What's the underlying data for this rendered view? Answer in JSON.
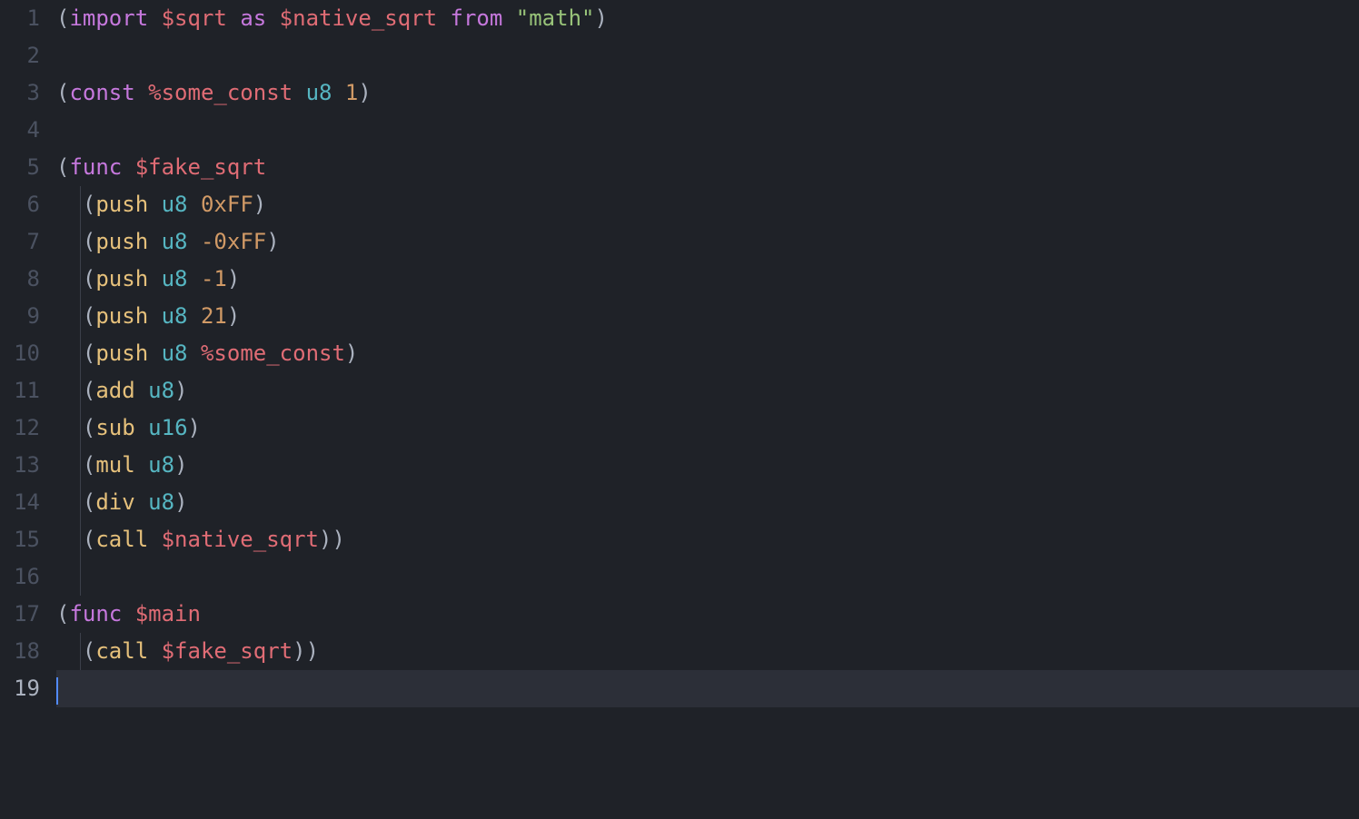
{
  "editor": {
    "active_line": 19,
    "lines": [
      {
        "n": 1,
        "indent_guide": false,
        "active": false
      },
      {
        "n": 2,
        "indent_guide": false,
        "active": false
      },
      {
        "n": 3,
        "indent_guide": false,
        "active": false
      },
      {
        "n": 4,
        "indent_guide": false,
        "active": false
      },
      {
        "n": 5,
        "indent_guide": false,
        "active": false
      },
      {
        "n": 6,
        "indent_guide": true,
        "active": false
      },
      {
        "n": 7,
        "indent_guide": true,
        "active": false
      },
      {
        "n": 8,
        "indent_guide": true,
        "active": false
      },
      {
        "n": 9,
        "indent_guide": true,
        "active": false
      },
      {
        "n": 10,
        "indent_guide": true,
        "active": false
      },
      {
        "n": 11,
        "indent_guide": true,
        "active": false
      },
      {
        "n": 12,
        "indent_guide": true,
        "active": false
      },
      {
        "n": 13,
        "indent_guide": true,
        "active": false
      },
      {
        "n": 14,
        "indent_guide": true,
        "active": false
      },
      {
        "n": 15,
        "indent_guide": true,
        "active": false
      },
      {
        "n": 16,
        "indent_guide": true,
        "active": false
      },
      {
        "n": 17,
        "indent_guide": false,
        "active": false
      },
      {
        "n": 18,
        "indent_guide": true,
        "active": false
      },
      {
        "n": 19,
        "indent_guide": false,
        "active": true
      }
    ]
  },
  "code": {
    "l1": [
      {
        "t": "(",
        "c": "pn"
      },
      {
        "t": "import",
        "c": "kw"
      },
      {
        "t": " "
      },
      {
        "t": "$sqrt",
        "c": "nm"
      },
      {
        "t": " "
      },
      {
        "t": "as",
        "c": "kw"
      },
      {
        "t": " "
      },
      {
        "t": "$native_sqrt",
        "c": "nm"
      },
      {
        "t": " "
      },
      {
        "t": "from",
        "c": "kw"
      },
      {
        "t": " "
      },
      {
        "t": "\"math\"",
        "c": "str"
      },
      {
        "t": ")",
        "c": "pn"
      }
    ],
    "l2": [],
    "l3": [
      {
        "t": "(",
        "c": "pn"
      },
      {
        "t": "const",
        "c": "kw"
      },
      {
        "t": " "
      },
      {
        "t": "%some_const",
        "c": "nm"
      },
      {
        "t": " "
      },
      {
        "t": "u8",
        "c": "ty"
      },
      {
        "t": " "
      },
      {
        "t": "1",
        "c": "num"
      },
      {
        "t": ")",
        "c": "pn"
      }
    ],
    "l4": [],
    "l5": [
      {
        "t": "(",
        "c": "pn"
      },
      {
        "t": "func",
        "c": "kw"
      },
      {
        "t": " "
      },
      {
        "t": "$fake_sqrt",
        "c": "nm"
      }
    ],
    "l6": [
      {
        "t": "  "
      },
      {
        "t": "(",
        "c": "pn"
      },
      {
        "t": "push",
        "c": "fn"
      },
      {
        "t": " "
      },
      {
        "t": "u8",
        "c": "ty"
      },
      {
        "t": " "
      },
      {
        "t": "0xFF",
        "c": "num"
      },
      {
        "t": ")",
        "c": "pn"
      }
    ],
    "l7": [
      {
        "t": "  "
      },
      {
        "t": "(",
        "c": "pn"
      },
      {
        "t": "push",
        "c": "fn"
      },
      {
        "t": " "
      },
      {
        "t": "u8",
        "c": "ty"
      },
      {
        "t": " "
      },
      {
        "t": "-0xFF",
        "c": "num"
      },
      {
        "t": ")",
        "c": "pn"
      }
    ],
    "l8": [
      {
        "t": "  "
      },
      {
        "t": "(",
        "c": "pn"
      },
      {
        "t": "push",
        "c": "fn"
      },
      {
        "t": " "
      },
      {
        "t": "u8",
        "c": "ty"
      },
      {
        "t": " "
      },
      {
        "t": "-1",
        "c": "num"
      },
      {
        "t": ")",
        "c": "pn"
      }
    ],
    "l9": [
      {
        "t": "  "
      },
      {
        "t": "(",
        "c": "pn"
      },
      {
        "t": "push",
        "c": "fn"
      },
      {
        "t": " "
      },
      {
        "t": "u8",
        "c": "ty"
      },
      {
        "t": " "
      },
      {
        "t": "21",
        "c": "num"
      },
      {
        "t": ")",
        "c": "pn"
      }
    ],
    "l10": [
      {
        "t": "  "
      },
      {
        "t": "(",
        "c": "pn"
      },
      {
        "t": "push",
        "c": "fn"
      },
      {
        "t": " "
      },
      {
        "t": "u8",
        "c": "ty"
      },
      {
        "t": " "
      },
      {
        "t": "%some_const",
        "c": "nm"
      },
      {
        "t": ")",
        "c": "pn"
      }
    ],
    "l11": [
      {
        "t": "  "
      },
      {
        "t": "(",
        "c": "pn"
      },
      {
        "t": "add",
        "c": "fn"
      },
      {
        "t": " "
      },
      {
        "t": "u8",
        "c": "ty"
      },
      {
        "t": ")",
        "c": "pn"
      }
    ],
    "l12": [
      {
        "t": "  "
      },
      {
        "t": "(",
        "c": "pn"
      },
      {
        "t": "sub",
        "c": "fn"
      },
      {
        "t": " "
      },
      {
        "t": "u16",
        "c": "ty"
      },
      {
        "t": ")",
        "c": "pn"
      }
    ],
    "l13": [
      {
        "t": "  "
      },
      {
        "t": "(",
        "c": "pn"
      },
      {
        "t": "mul",
        "c": "fn"
      },
      {
        "t": " "
      },
      {
        "t": "u8",
        "c": "ty"
      },
      {
        "t": ")",
        "c": "pn"
      }
    ],
    "l14": [
      {
        "t": "  "
      },
      {
        "t": "(",
        "c": "pn"
      },
      {
        "t": "div",
        "c": "fn"
      },
      {
        "t": " "
      },
      {
        "t": "u8",
        "c": "ty"
      },
      {
        "t": ")",
        "c": "pn"
      }
    ],
    "l15": [
      {
        "t": "  "
      },
      {
        "t": "(",
        "c": "pn"
      },
      {
        "t": "call",
        "c": "fn"
      },
      {
        "t": " "
      },
      {
        "t": "$native_sqrt",
        "c": "nm"
      },
      {
        "t": ")",
        "c": "pn"
      },
      {
        "t": ")",
        "c": "pn"
      }
    ],
    "l16": [],
    "l17": [
      {
        "t": "(",
        "c": "pn"
      },
      {
        "t": "func",
        "c": "kw"
      },
      {
        "t": " "
      },
      {
        "t": "$main",
        "c": "nm"
      }
    ],
    "l18": [
      {
        "t": "  "
      },
      {
        "t": "(",
        "c": "pn"
      },
      {
        "t": "call",
        "c": "fn"
      },
      {
        "t": " "
      },
      {
        "t": "$fake_sqrt",
        "c": "nm"
      },
      {
        "t": ")",
        "c": "pn"
      },
      {
        "t": ")",
        "c": "pn"
      }
    ],
    "l19": []
  }
}
